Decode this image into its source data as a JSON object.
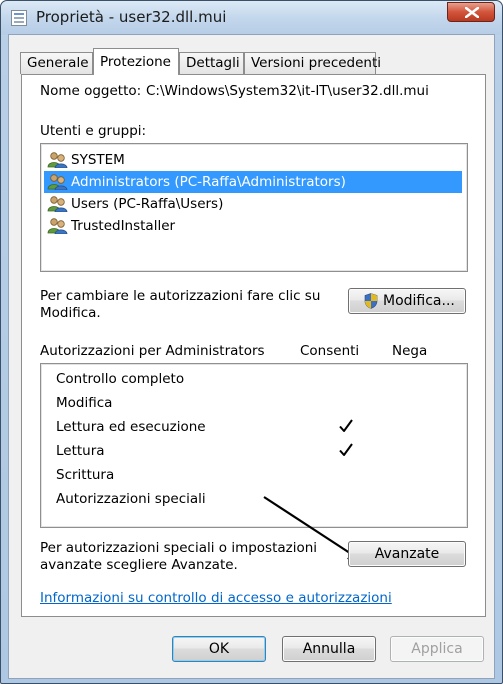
{
  "window": {
    "title": "Proprietà - user32.dll.mui",
    "close_icon": "close-icon"
  },
  "tabs": [
    {
      "label": "Generale",
      "active": false
    },
    {
      "label": "Protezione",
      "active": true
    },
    {
      "label": "Dettagli",
      "active": false
    },
    {
      "label": "Versioni precedenti",
      "active": false
    }
  ],
  "object": {
    "label": "Nome oggetto:",
    "value": "C:\\Windows\\System32\\it-IT\\user32.dll.mui"
  },
  "users": {
    "label": "Utenti e gruppi:",
    "items": [
      {
        "name": "SYSTEM",
        "selected": false,
        "icon": "users-group-icon"
      },
      {
        "name": "Administrators (PC-Raffa\\Administrators)",
        "selected": true,
        "icon": "users-group-icon"
      },
      {
        "name": "Users (PC-Raffa\\Users)",
        "selected": false,
        "icon": "users-group-icon"
      },
      {
        "name": "TrustedInstaller",
        "selected": false,
        "icon": "users-group-icon"
      }
    ]
  },
  "change": {
    "text": "Per cambiare le autorizzazioni fare clic su Modifica.",
    "button_label": "Modifica...",
    "button_icon": "uac-shield-icon"
  },
  "permissions": {
    "header_label": "Autorizzazioni per Administrators",
    "allow_label": "Consenti",
    "deny_label": "Nega",
    "rows": [
      {
        "name": "Controllo completo",
        "allow": false,
        "deny": false
      },
      {
        "name": "Modifica",
        "allow": false,
        "deny": false
      },
      {
        "name": "Lettura ed esecuzione",
        "allow": true,
        "deny": false
      },
      {
        "name": "Lettura",
        "allow": true,
        "deny": false
      },
      {
        "name": "Scrittura",
        "allow": false,
        "deny": false
      },
      {
        "name": "Autorizzazioni speciali",
        "allow": false,
        "deny": false
      }
    ]
  },
  "advanced": {
    "text": "Per autorizzazioni speciali o impostazioni avanzate scegliere Avanzate.",
    "button_label": "Avanzate"
  },
  "help_link": "Informazioni su controllo di accesso e autorizzazioni",
  "footer": {
    "ok_label": "OK",
    "cancel_label": "Annulla",
    "apply_label": "Applica"
  },
  "colors": {
    "selection": "#3399ff",
    "link": "#0066cc",
    "annotation_arrow": "#000000"
  }
}
